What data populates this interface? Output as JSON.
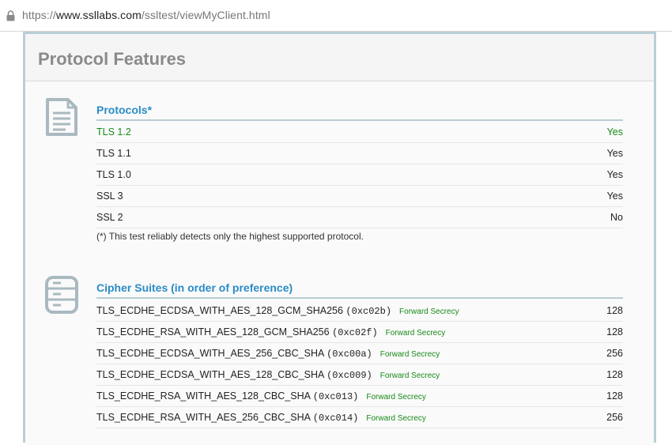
{
  "browser": {
    "url_scheme": "https://",
    "url_domain": "www.ssllabs.com",
    "url_path": "/ssltest/viewMyClient.html",
    "lock_icon": "lock-icon"
  },
  "panel": {
    "title": "Protocol Features"
  },
  "protocols": {
    "icon": "document-icon",
    "heading": "Protocols*",
    "rows": [
      {
        "label": "TLS 1.2",
        "value": "Yes"
      },
      {
        "label": "TLS 1.1",
        "value": "Yes"
      },
      {
        "label": "TLS 1.0",
        "value": "Yes"
      },
      {
        "label": "SSL 3",
        "value": "Yes"
      },
      {
        "label": "SSL 2",
        "value": "No"
      }
    ],
    "note": "(*) This test reliably detects only the highest supported protocol."
  },
  "ciphers": {
    "icon": "cipher-list-icon",
    "heading": "Cipher Suites (in order of preference)",
    "rows": [
      {
        "name": "TLS_ECDHE_ECDSA_WITH_AES_128_GCM_SHA256",
        "code": "(0xc02b)",
        "tag": "Forward Secrecy",
        "bits": "128"
      },
      {
        "name": "TLS_ECDHE_RSA_WITH_AES_128_GCM_SHA256",
        "code": "(0xc02f)",
        "tag": "Forward Secrecy",
        "bits": "128"
      },
      {
        "name": "TLS_ECDHE_ECDSA_WITH_AES_256_CBC_SHA",
        "code": "(0xc00a)",
        "tag": "Forward Secrecy",
        "bits": "256"
      },
      {
        "name": "TLS_ECDHE_ECDSA_WITH_AES_128_CBC_SHA",
        "code": "(0xc009)",
        "tag": "Forward Secrecy",
        "bits": "128"
      },
      {
        "name": "TLS_ECDHE_RSA_WITH_AES_128_CBC_SHA",
        "code": "(0xc013)",
        "tag": "Forward Secrecy",
        "bits": "128"
      },
      {
        "name": "TLS_ECDHE_RSA_WITH_AES_256_CBC_SHA",
        "code": "(0xc014)",
        "tag": "Forward Secrecy",
        "bits": "256"
      }
    ]
  },
  "colors": {
    "heading_blue": "#2a8cc8",
    "highlight_green": "#1a8a1a",
    "frame_border": "#b8cfd6"
  }
}
